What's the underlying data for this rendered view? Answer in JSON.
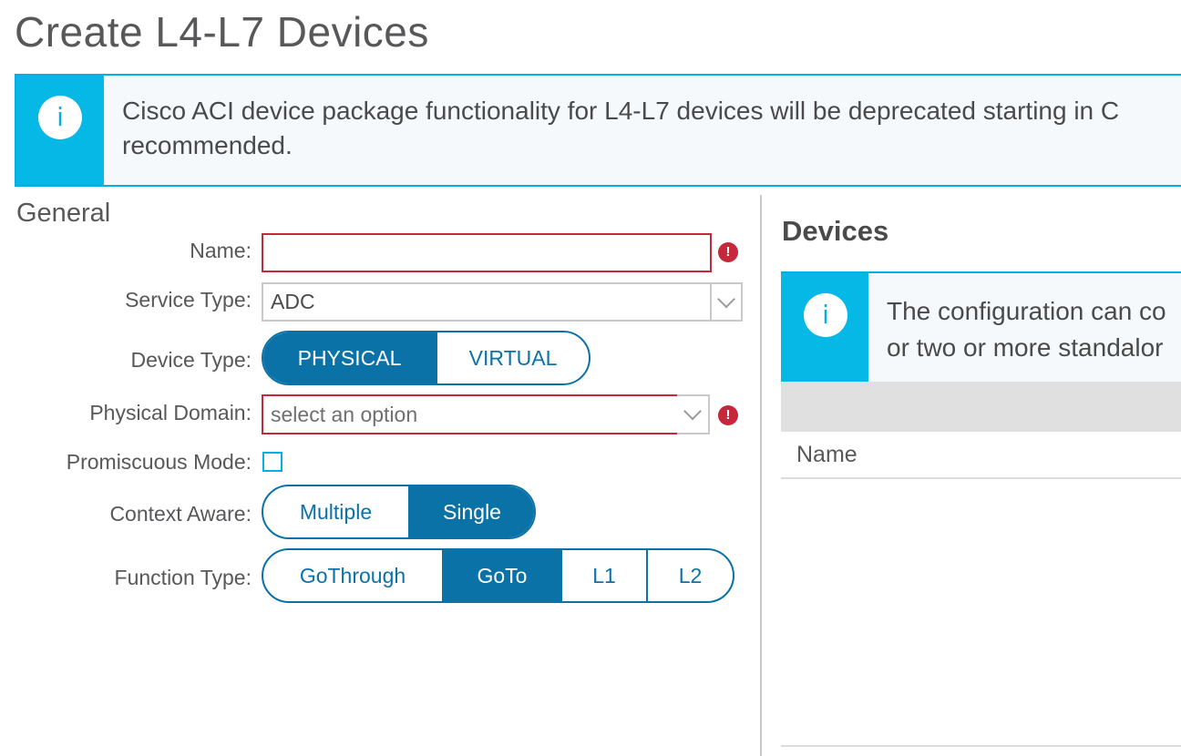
{
  "page": {
    "title": "Create L4-L7 Devices"
  },
  "banner_top": {
    "icon": "info-icon",
    "line1": "Cisco ACI device package functionality for L4-L7 devices will be deprecated starting in C",
    "line2": "recommended."
  },
  "general": {
    "heading": "General",
    "name": {
      "label": "Name:",
      "value": ""
    },
    "service_type": {
      "label": "Service Type:",
      "value": "ADC"
    },
    "device_type": {
      "label": "Device Type:",
      "options": [
        "PHYSICAL",
        "VIRTUAL"
      ],
      "selected": "PHYSICAL"
    },
    "physical_domain": {
      "label": "Physical Domain:",
      "placeholder": "select an option"
    },
    "promiscuous_mode": {
      "label": "Promiscuous Mode:",
      "checked": false
    },
    "context_aware": {
      "label": "Context Aware:",
      "options": [
        "Multiple",
        "Single"
      ],
      "selected": "Single"
    },
    "function_type": {
      "label": "Function Type:",
      "options": [
        "GoThrough",
        "GoTo",
        "L1",
        "L2"
      ],
      "selected": "GoTo"
    }
  },
  "devices": {
    "heading": "Devices",
    "banner": {
      "icon": "info-icon",
      "line1": "The configuration can co",
      "line2": "or two or more standalor"
    },
    "table": {
      "columns": [
        "Name"
      ]
    }
  },
  "colors": {
    "accent": "#0b72a8",
    "info": "#05b8e6",
    "error": "#c4283a"
  }
}
